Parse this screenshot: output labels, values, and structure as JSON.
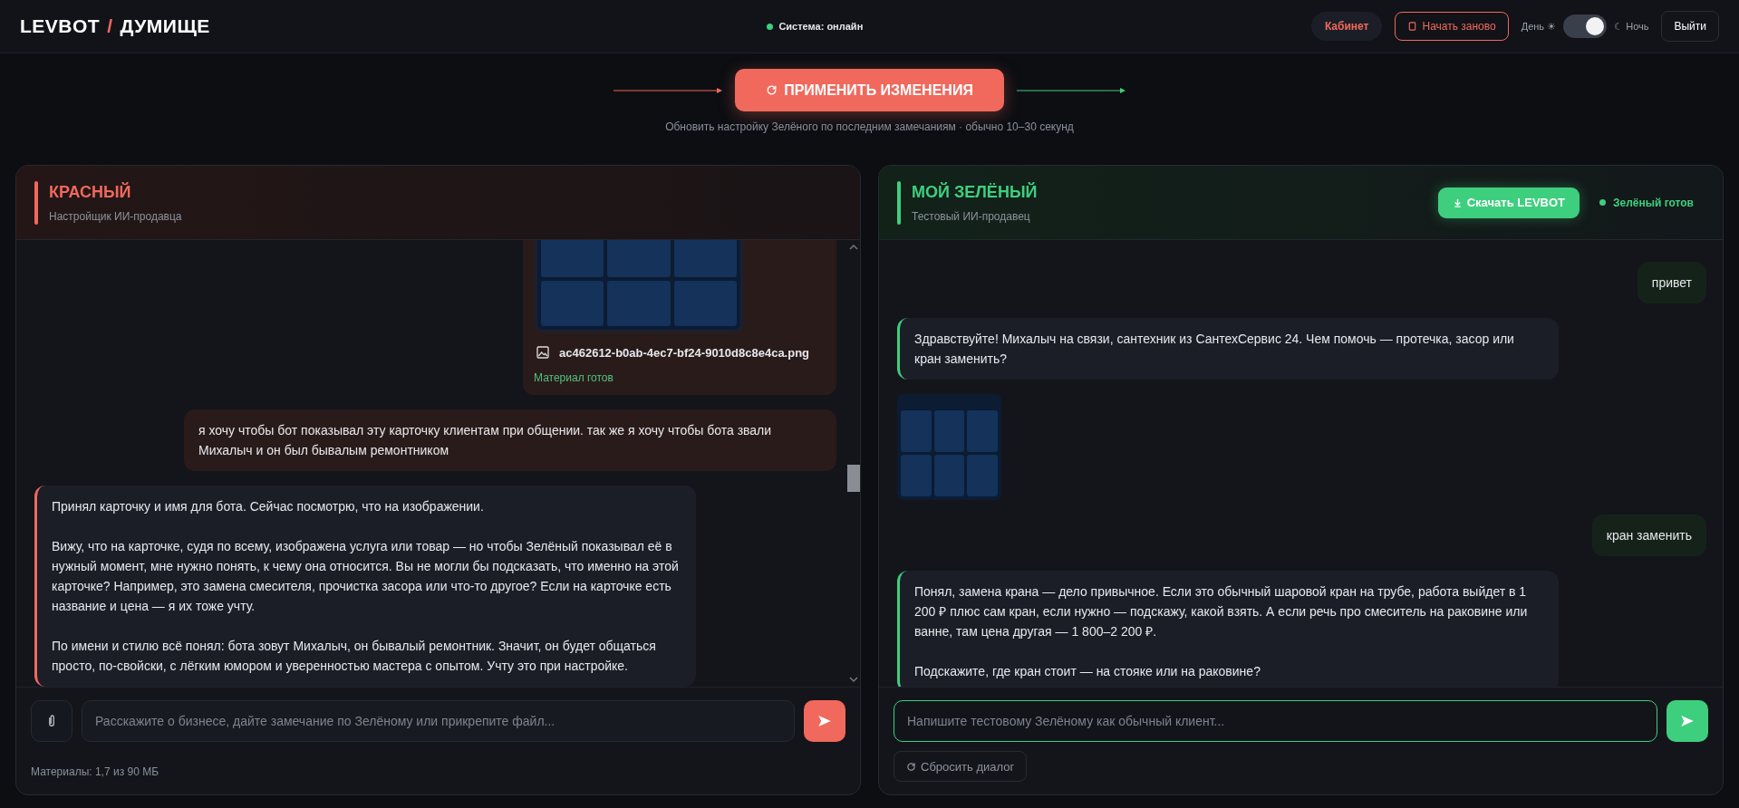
{
  "header": {
    "logo": {
      "brand": "LEVBOT",
      "separator": "/",
      "name": "ДУМИЩЕ"
    },
    "status": {
      "label": "Система: онлайн",
      "online": true
    },
    "cabinet_button": "Кабинет",
    "restart_button": "Начать заново",
    "theme_toggle": {
      "day_label": "День ☀",
      "night_label": "☾ Ночь",
      "night": true
    },
    "logout_button": "Выйти"
  },
  "apply": {
    "button": "ПРИМЕНИТЬ ИЗМЕНЕНИЯ",
    "hint": "Обновить настройку Зелёного по последним замечаниям · обычно 10–30 секунд"
  },
  "left_panel": {
    "title": "КРАСНЫЙ",
    "subtitle": "Настройщик ИИ-продавца",
    "messages": [
      {
        "kind": "file",
        "file_name": "ac462612-b0ab-4ec7-bf24-9010d8c8e4ca.png",
        "status": "Материал готов"
      },
      {
        "kind": "user",
        "paragraphs": [
          "я хочу чтобы бот показывал эту карточку клиентам при общении. так же я хочу чтобы бота звали Михалыч и он был бывалым ремонтником"
        ]
      },
      {
        "kind": "bot",
        "paragraphs": [
          "Принял карточку и имя для бота. Сейчас посмотрю, что на изображении.",
          "Вижу, что на карточке, судя по всему, изображена услуга или товар — но чтобы Зелёный показывал её в нужный момент, мне нужно понять, к чему она относится. Вы не могли бы подсказать, что именно на этой карточке? Например, это замена смесителя, прочистка засора или что-то другое? Если на карточке есть название и цена — я их тоже учту.",
          "По имени и стилю всё понял: бота зовут Михалыч, он бывалый ремонтник. Значит, он будет общаться просто, по-свойски, с лёгким юмором и уверенностью мастера с опытом. Учту это при настройке."
        ]
      }
    ],
    "input": {
      "placeholder": "Расскажите о бизнесе, дайте замечание по Зелёному или прикрепите файл..."
    },
    "footer": "Материалы: 1,7 из 90 МБ"
  },
  "right_panel": {
    "title": "МОЙ ЗЕЛЁНЫЙ",
    "subtitle": "Тестовый ИИ-продавец",
    "download_button": "Скачать LEVBOT",
    "status": {
      "label": "Зелёный готов",
      "ready": true
    },
    "messages": [
      {
        "kind": "user",
        "paragraphs": [
          "привет"
        ]
      },
      {
        "kind": "bot",
        "paragraphs": [
          "Здравствуйте! Михалыч на связи, сантехник из СантехСервис 24. Чем помочь — протечка, засор или кран заменить?"
        ]
      },
      {
        "kind": "image"
      },
      {
        "kind": "user",
        "paragraphs": [
          "кран заменить"
        ]
      },
      {
        "kind": "bot",
        "paragraphs": [
          "Понял, замена крана — дело привычное. Если это обычный шаровой кран на трубе, работа выйдет в 1 200 ₽ плюс сам кран, если нужно — подскажу, какой взять. А если речь про смеситель на раковине или ванне, там цена другая — 1 800–2 200 ₽.",
          "Подскажите, где кран стоит — на стояке или на раковине?"
        ]
      }
    ],
    "input": {
      "placeholder": "Напишите тестовому Зелёному как обычный клиент..."
    },
    "reset_button": "Сбросить диалог"
  }
}
